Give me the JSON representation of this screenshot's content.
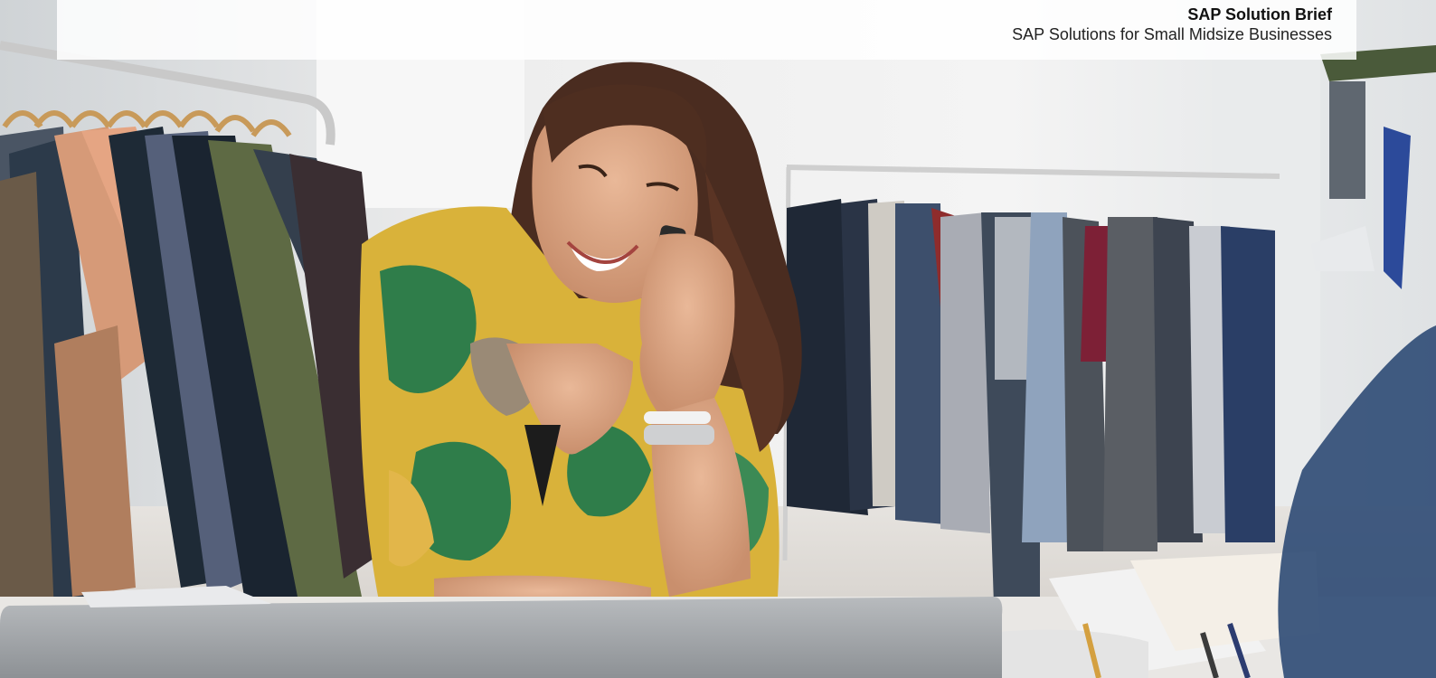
{
  "header": {
    "title": "SAP Solution Brief",
    "subtitle": "SAP Solutions for Small Midsize Businesses"
  },
  "hero_image": {
    "icon": "photo-woman-on-phone-in-clothing-store"
  }
}
